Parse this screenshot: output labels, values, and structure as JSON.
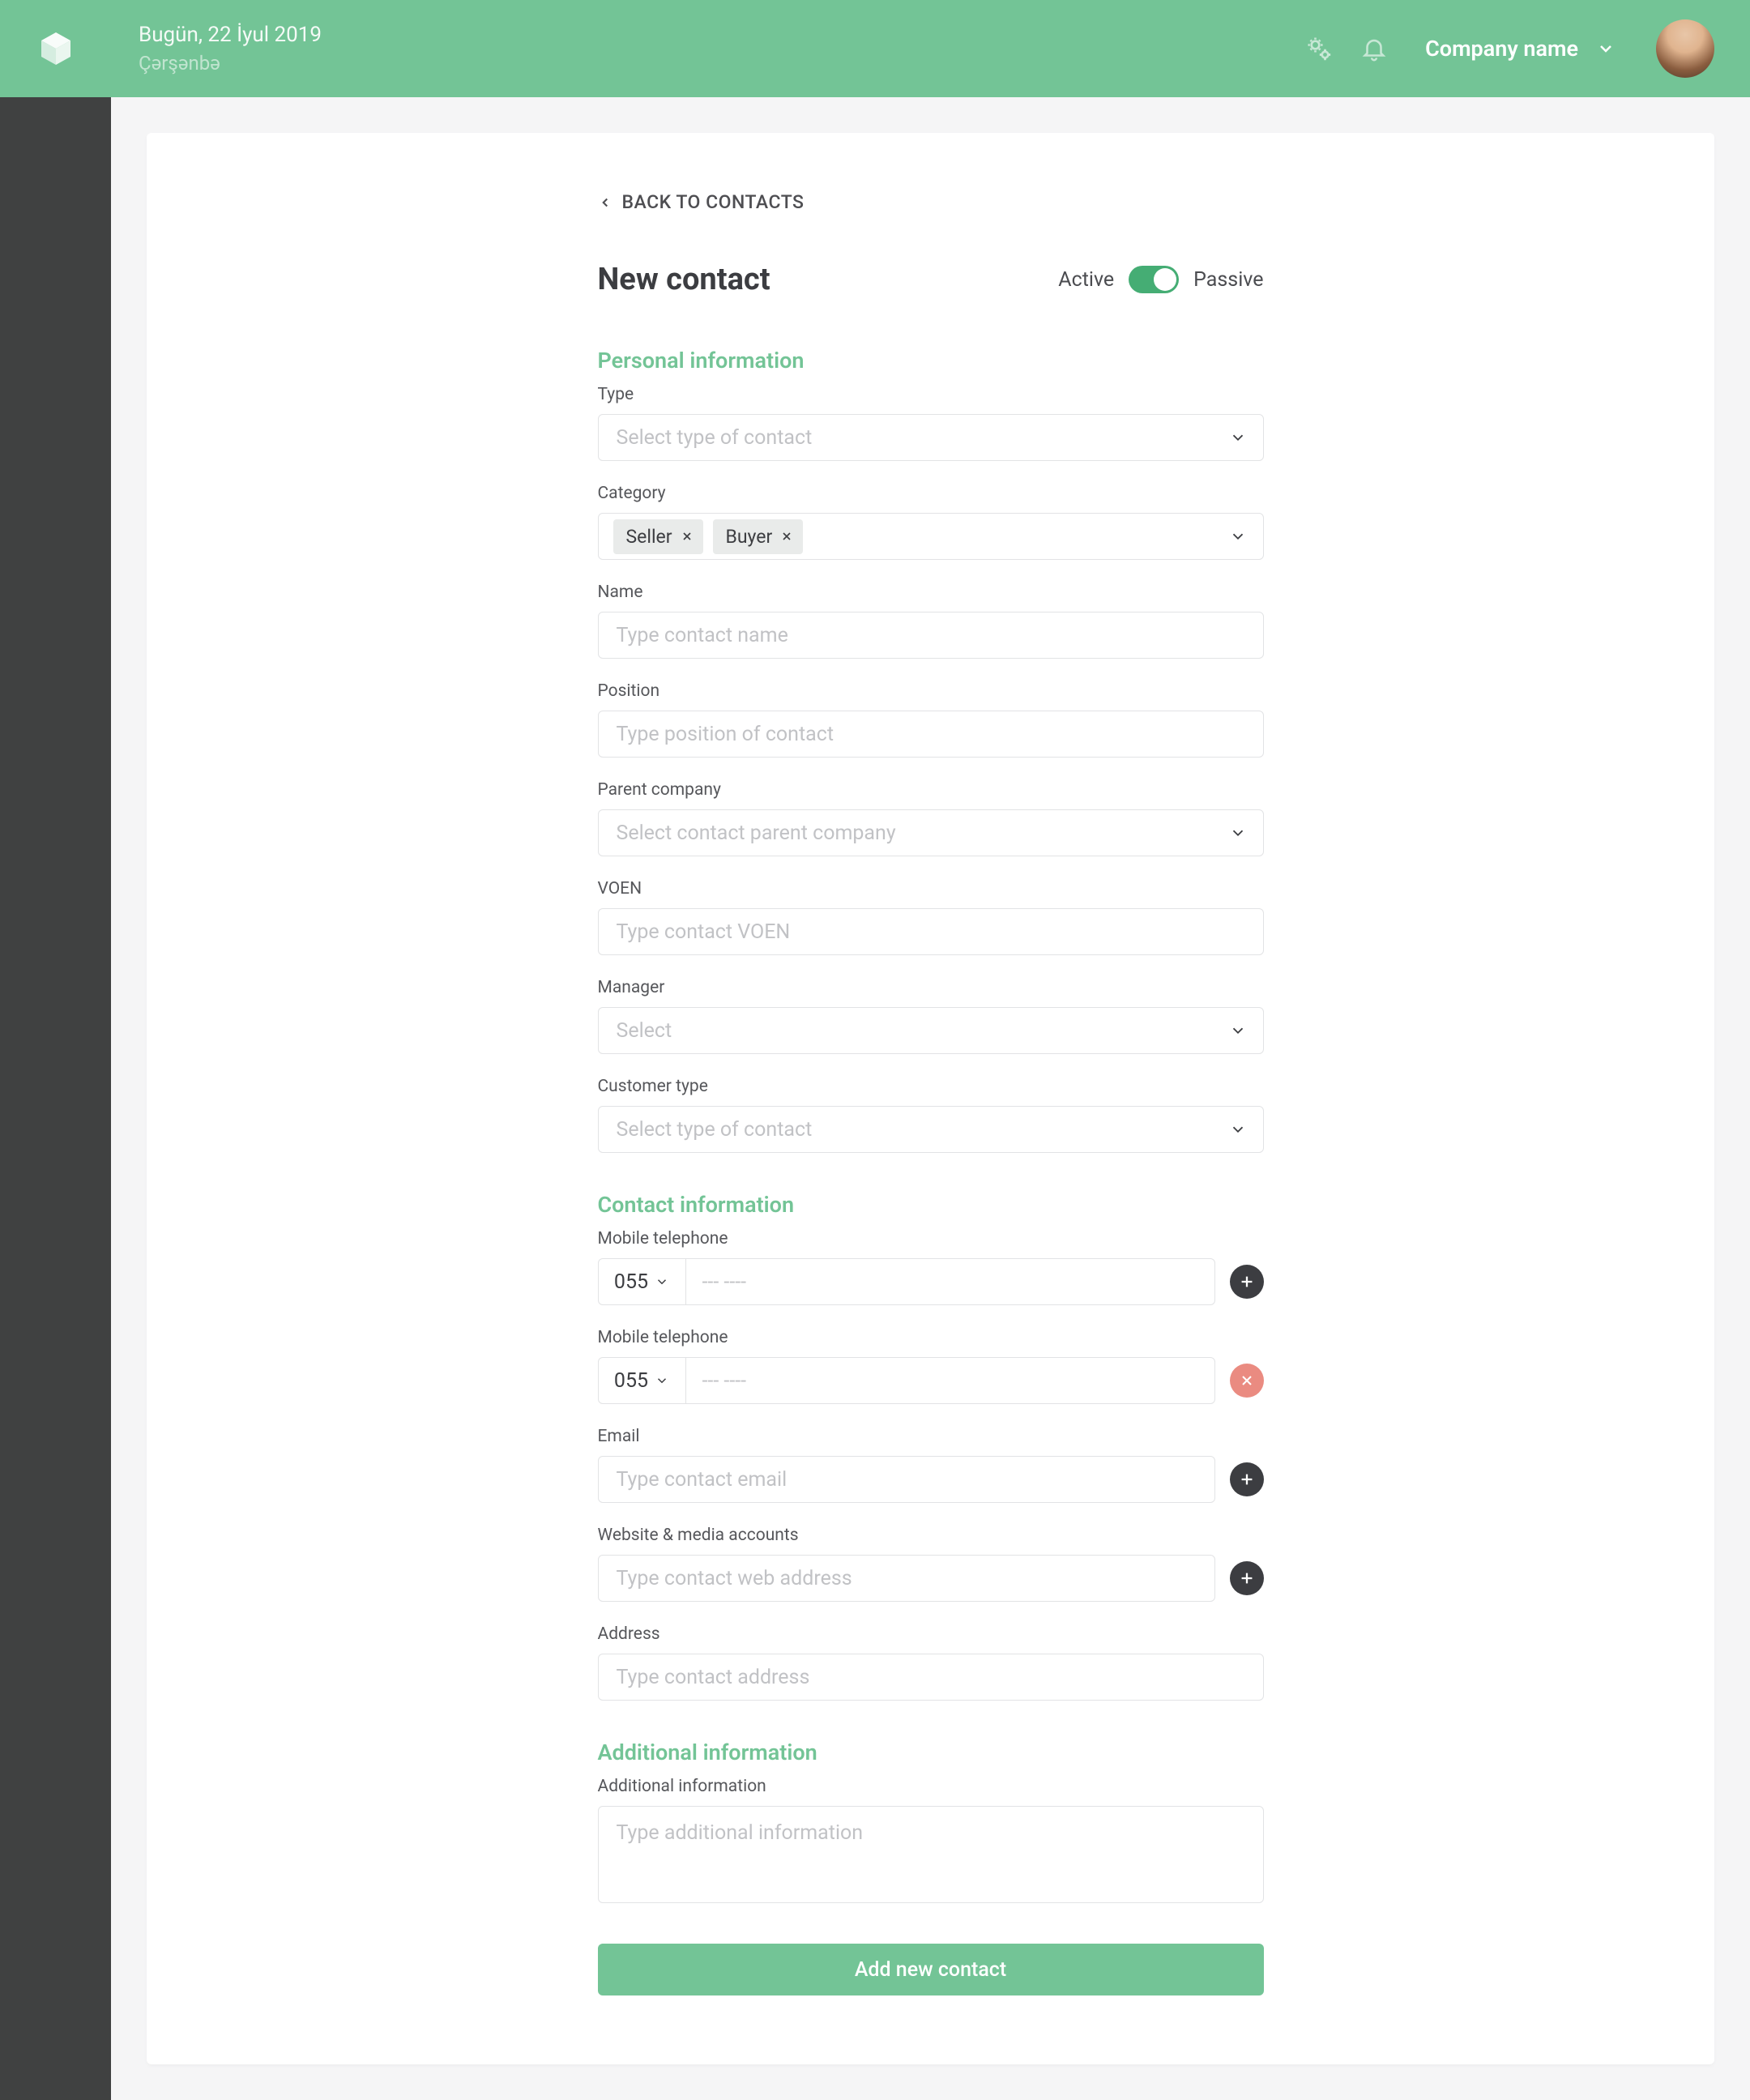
{
  "header": {
    "date": "Bugün, 22 İyul 2019",
    "day": "Çərşənbə",
    "company_name": "Company name"
  },
  "nav": {
    "back_to_contacts": "BACK TO CONTACTS"
  },
  "page": {
    "title": "New contact",
    "active_label": "Active",
    "passive_label": "Passive"
  },
  "sections": {
    "personal": "Personal information",
    "contact": "Contact information",
    "additional": "Additional information"
  },
  "fields": {
    "type": {
      "label": "Type",
      "placeholder": "Select type of contact"
    },
    "category": {
      "label": "Category"
    },
    "name": {
      "label": "Name",
      "placeholder": "Type contact name"
    },
    "position": {
      "label": "Position",
      "placeholder": "Type position of contact"
    },
    "parent_company": {
      "label": "Parent company",
      "placeholder": "Select contact parent company"
    },
    "voen": {
      "label": "VOEN",
      "placeholder": "Type contact VOEN"
    },
    "manager": {
      "label": "Manager",
      "placeholder": "Select"
    },
    "customer_type": {
      "label": "Customer type",
      "placeholder": "Select type of contact"
    },
    "mobile1": {
      "label": "Mobile telephone",
      "prefix": "055",
      "placeholder": "--- ----"
    },
    "mobile2": {
      "label": "Mobile telephone",
      "prefix": "055",
      "placeholder": "--- ----"
    },
    "email": {
      "label": "Email",
      "placeholder": "Type contact email"
    },
    "website": {
      "label": "Website & media accounts",
      "placeholder": "Type contact web address"
    },
    "address": {
      "label": "Address",
      "placeholder": "Type contact address"
    },
    "additional_info": {
      "label": "Additional information",
      "placeholder": "Type additional information"
    }
  },
  "tags": {
    "seller": "Seller",
    "buyer": "Buyer"
  },
  "buttons": {
    "submit": "Add new contact"
  }
}
